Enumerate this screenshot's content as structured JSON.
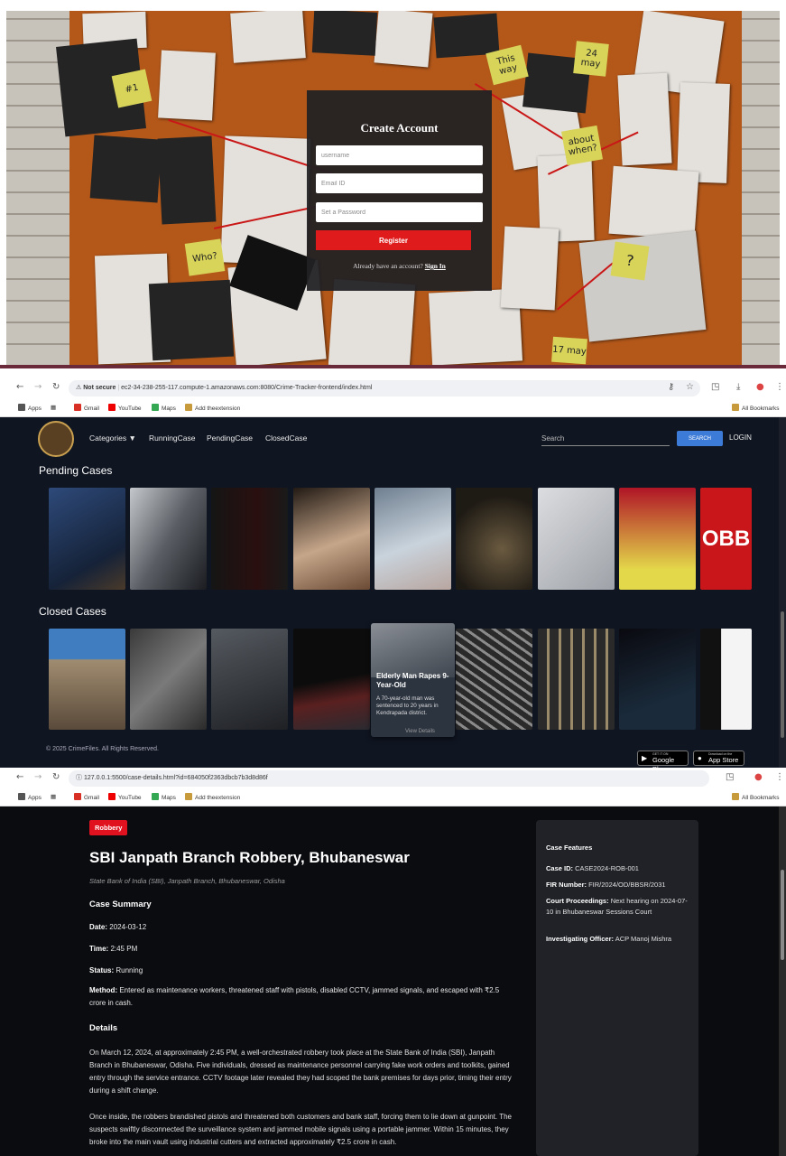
{
  "register": {
    "title": "Create Account",
    "username_placeholder": "username",
    "email_placeholder": "Email ID",
    "password_placeholder": "Set a Password",
    "register_label": "Register",
    "already_text": "Already have an account?",
    "signin_label": "Sign In",
    "sticky_notes": [
      "#1",
      "This way",
      "24 may",
      "Who?",
      "about when?",
      "?",
      "17 may"
    ]
  },
  "browser2": {
    "not_secure": "Not secure",
    "url": "ec2-34-238-255-117.compute-1.amazonaws.com:8080/Crime-Tracker-frontend/index.html",
    "bookmarks": [
      "Apps",
      "Gmail",
      "YouTube",
      "Maps",
      "Add theextension"
    ],
    "all_bookmarks": "All Bookmarks"
  },
  "crimefiles": {
    "nav": [
      "Categories ▼",
      "RunningCase",
      "PendingCase",
      "ClosedCase"
    ],
    "search_placeholder": "Search",
    "search_label": "SEARCH",
    "login_label": "LOGIN",
    "pending_heading": "Pending Cases",
    "closed_heading": "Closed Cases",
    "hover_card": {
      "title": "Elderly Man Rapes 9-Year-Old",
      "desc": "A 70-year-old man was sentenced to 20 years in Kendrapada district.",
      "more": "View Details"
    },
    "copyright": "© 2025 CrimeFiles. All Rights Reserved.",
    "google_play": {
      "mini": "GET IT ON",
      "big": "Google Play"
    },
    "app_store": {
      "mini": "Download on the",
      "big": "App Store"
    }
  },
  "browser3": {
    "url": "127.0.0.1:5500/case-details.html?id=684050f2363dbcb7b3d8d86f",
    "bookmarks": [
      "Apps",
      "Gmail",
      "YouTube",
      "Maps",
      "Add theextension"
    ],
    "all_bookmarks": "All Bookmarks"
  },
  "case": {
    "category": "Robbery",
    "title": "SBI Janpath Branch Robbery, Bhubaneswar",
    "location": "State Bank of India (SBI), Janpath Branch, Bhubaneswar, Odisha",
    "summary_heading": "Case Summary",
    "date_label": "Date:",
    "date": "2024-03-12",
    "time_label": "Time:",
    "time": "2:45 PM",
    "status_label": "Status:",
    "status": "Running",
    "method_label": "Method:",
    "method": "Entered as maintenance workers, threatened staff with pistols, disabled CCTV, jammed signals, and escaped with ₹2.5 crore in cash.",
    "details_heading": "Details",
    "details_p1": "On March 12, 2024, at approximately 2:45 PM, a well-orchestrated robbery took place at the State Bank of India (SBI), Janpath Branch in Bhubaneswar, Odisha. Five individuals, dressed as maintenance personnel carrying fake work orders and toolkits, gained entry through the service entrance. CCTV footage later revealed they had scoped the bank premises for days prior, timing their entry during a shift change.",
    "details_p2": "Once inside, the robbers brandished pistols and threatened both customers and bank staff, forcing them to lie down at gunpoint. The suspects swiftly disconnected the surveillance system and jammed mobile signals using a portable jammer. Within 15 minutes, they broke into the main vault using industrial cutters and extracted approximately ₹2.5 crore in cash."
  },
  "features": {
    "heading": "Case Features",
    "case_id_label": "Case ID:",
    "case_id": "CASE2024-ROB-001",
    "fir_label": "FIR Number:",
    "fir": "FIR/2024/OD/BBSR/2031",
    "court_label": "Court Proceedings:",
    "court": "Next hearing on 2024-07-10 in Bhubaneswar Sessions Court",
    "officer_label": "Investigating Officer:",
    "officer": "ACP Manoj Mishra"
  }
}
